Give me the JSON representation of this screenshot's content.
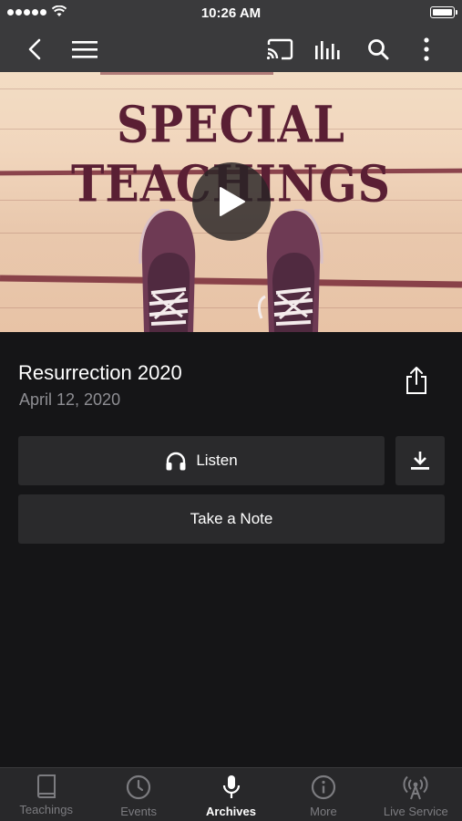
{
  "status_bar": {
    "time": "10:26 AM"
  },
  "nav": {
    "icons": [
      "back-icon",
      "menu-icon",
      "cast-icon",
      "equalizer-icon",
      "search-icon",
      "more-icon"
    ]
  },
  "hero": {
    "title": "SPECIAL TEACHINGS"
  },
  "media": {
    "title": "Resurrection 2020",
    "date": "April 12, 2020"
  },
  "actions": {
    "listen_label": "Listen",
    "note_label": "Take a Note"
  },
  "tabs": [
    {
      "label": "Teachings",
      "icon": "book-icon",
      "active": false
    },
    {
      "label": "Events",
      "icon": "clock-icon",
      "active": false
    },
    {
      "label": "Archives",
      "icon": "microphone-icon",
      "active": true
    },
    {
      "label": "More",
      "icon": "info-icon",
      "active": false
    },
    {
      "label": "Live Service",
      "icon": "broadcast-icon",
      "active": false
    }
  ],
  "colors": {
    "bar_bg": "#3a3a3c",
    "content_bg": "#151517",
    "button_bg": "#2a2a2c",
    "secondary_text": "#8e8e93",
    "hero_title": "#5a1f34"
  }
}
